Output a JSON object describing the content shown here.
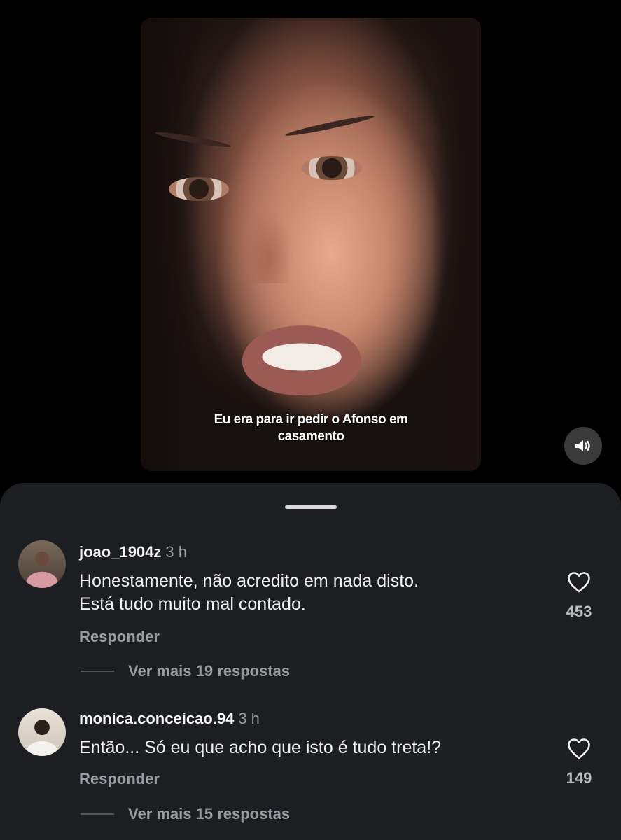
{
  "video": {
    "subtitle_line1": "Eu era para ir pedir o Afonso em",
    "subtitle_line2": "casamento",
    "sound_icon": "speaker-icon"
  },
  "comments": [
    {
      "username": "joao_1904z",
      "time": "3 h",
      "text_line1": "Honestamente, não acredito em nada disto.",
      "text_line2": "Está tudo muito mal contado.",
      "likes": "453",
      "reply_label": "Responder",
      "more_replies": "Ver mais 19 respostas"
    },
    {
      "username": "monica.conceicao.94",
      "time": "3 h",
      "text_line1": "Então... Só eu que acho que isto é tudo treta!?",
      "likes": "149",
      "reply_label": "Responder",
      "more_replies": "Ver mais 15 respostas"
    }
  ]
}
